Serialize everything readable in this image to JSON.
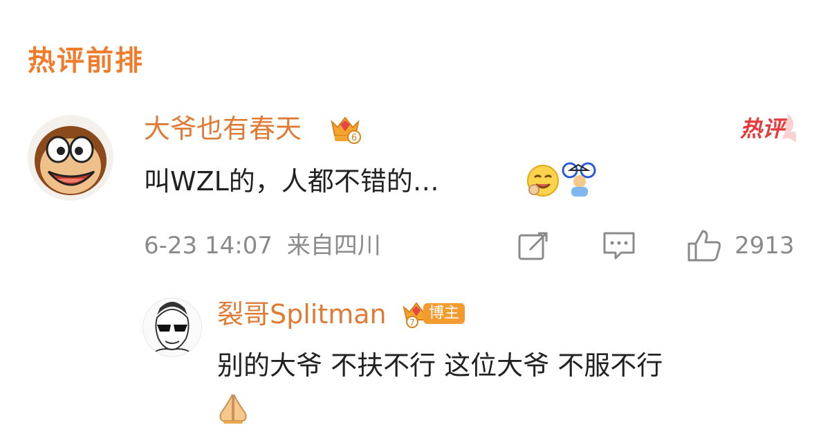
{
  "section_title": "热评前排",
  "main_comment": {
    "username": "大爷也有春天",
    "badge_level": "6",
    "hot_label": "热评",
    "text": "叫WZL的，人都不错的…",
    "timestamp": "6-23 14:07",
    "location": "来自四川",
    "like_count": "2913",
    "emojis": [
      "yummy-face-emoji",
      "cyclist-emoji"
    ]
  },
  "reply": {
    "username": "裂哥Splitman",
    "badge_level": "7",
    "tag": "博主",
    "text": "别的大爷 不扶不行 这位大爷 不服不行",
    "emojis": [
      "pray-hands-emoji"
    ]
  },
  "colors": {
    "accent_orange": "#f07c2b",
    "username_orange": "#e07b36",
    "hot_red": "#e53a3a",
    "meta_gray": "#8a8a8a",
    "text_dark": "#222222"
  }
}
